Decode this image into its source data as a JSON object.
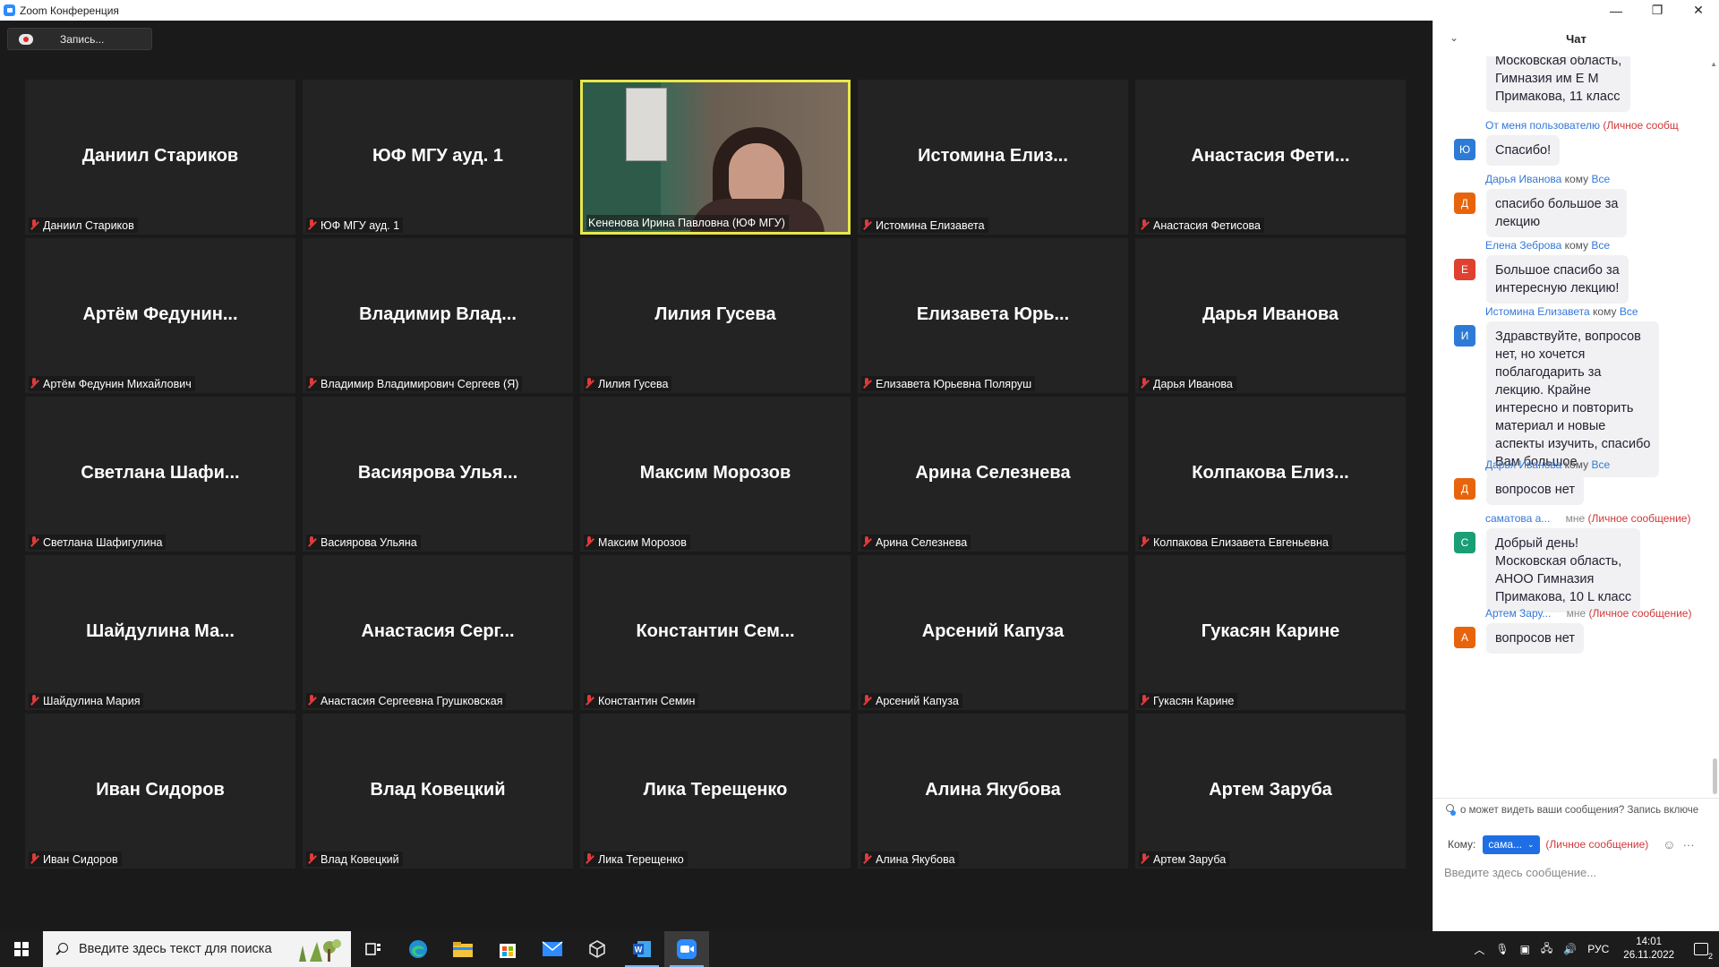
{
  "window": {
    "title": "Zoom Конференция",
    "controls": [
      "—",
      "❐",
      "✕"
    ]
  },
  "recording": {
    "label": "Запись..."
  },
  "speaker": {
    "name": "Keненова Ирина Павловна (ЮФ МГУ)"
  },
  "tiles": [
    {
      "big": "Даниил Стариков",
      "small": "Даниил Стариков"
    },
    {
      "big": "ЮФ МГУ ауд. 1",
      "small": "ЮФ МГУ ауд. 1"
    },
    {
      "big": "",
      "small": "Keненова Ирина Павловна (ЮФ МГУ)",
      "speaker": true
    },
    {
      "big": "Истомина  Елиз...",
      "small": "Истомина Елизавета"
    },
    {
      "big": "Анастасия  Фети...",
      "small": "Анастасия Фетисова"
    },
    {
      "big": "Артём  Федунин...",
      "small": "Артём Федунин Михайлович"
    },
    {
      "big": "Владимир  Влад...",
      "small": "Владимир Владимирович Сергеев (Я)"
    },
    {
      "big": "Лилия Гусева",
      "small": "Лилия Гусева"
    },
    {
      "big": "Елизавета  Юрь...",
      "small": "Елизавета Юрьевна Поляруш"
    },
    {
      "big": "Дарья Иванова",
      "small": "Дарья Иванова"
    },
    {
      "big": "Светлана  Шафи...",
      "small": "Светлана Шафигулина"
    },
    {
      "big": "Васиярова  Улья...",
      "small": "Васиярова Ульяна"
    },
    {
      "big": "Максим Морозов",
      "small": "Максим Морозов"
    },
    {
      "big": "Арина Селезнева",
      "small": "Арина Селезнева"
    },
    {
      "big": "Колпакова  Елиз...",
      "small": "Колпакова Елизавета Евгеньевна"
    },
    {
      "big": "Шайдулина  Ма...",
      "small": "Шайдулина Мария"
    },
    {
      "big": "Анастасия  Серг...",
      "small": "Анастасия Сергеевна Грушковская"
    },
    {
      "big": "Константин  Сем...",
      "small": "Константин Семин"
    },
    {
      "big": "Арсений Капуза",
      "small": "Арсений Капуза"
    },
    {
      "big": "Гукасян Карине",
      "small": "Гукасян Карине"
    },
    {
      "big": "Иван Сидоров",
      "small": "Иван Сидоров"
    },
    {
      "big": "Влад Ковецкий",
      "small": "Влад Ковецкий"
    },
    {
      "big": "Лика Терещенко",
      "small": "Лика Терещенко"
    },
    {
      "big": "Алина Якубова",
      "small": "Алина Якубова"
    },
    {
      "big": "Артем Заруба",
      "small": "Артем Заруба"
    }
  ],
  "chat": {
    "title": "Чат",
    "messages": [
      {
        "avatar": "",
        "avatar_color": "#1a9e75",
        "meta": null,
        "text": [
          "Московская область,",
          "Гимназия им Е М",
          "Примакова, 11 класс"
        ]
      },
      {
        "avatar": "Ю",
        "avatar_color": "#2d7bd6",
        "meta": {
          "sender": "От меня пользователю",
          "priv": "(Личное сообщ"
        },
        "text": [
          "Спасибо!"
        ]
      },
      {
        "avatar": "Д",
        "avatar_color": "#e8640c",
        "meta": {
          "sender": "Дарья Иванова",
          "kw": "кому",
          "all": "Все"
        },
        "text": [
          "спасибо большое за",
          "лекцию"
        ]
      },
      {
        "avatar": "Е",
        "avatar_color": "#e04030",
        "meta": {
          "sender": "Елена Зеброва",
          "kw": "кому",
          "all": "Все"
        },
        "text": [
          "Большое спасибо за",
          "интересную лекцию!"
        ]
      },
      {
        "avatar": "И",
        "avatar_color": "#2d7bd6",
        "meta": {
          "sender": "Истомина Елизавета",
          "kw": "кому",
          "all": "Все"
        },
        "text": [
          "Здравствуйте, вопросов",
          "нет, но хочется",
          "поблагодарить за",
          "лекцию. Крайне",
          "интересно и повторить",
          "материал и новые",
          "аспекты изучить, спасибо",
          "Вам большое"
        ]
      },
      {
        "avatar": "Д",
        "avatar_color": "#e8640c",
        "meta": {
          "sender": "Дарья Иванова",
          "kw": "кому",
          "all": "Все"
        },
        "text": [
          "вопросов нет"
        ]
      },
      {
        "avatar": "С",
        "avatar_color": "#1a9e75",
        "meta": {
          "sender": "саматова а...",
          "me": "мне",
          "priv": "(Личное сообщение)"
        },
        "text": [
          "Добрый день!",
          "Московская область,",
          "АНОО Гимназия",
          "Примакова, 10 L класс"
        ]
      },
      {
        "avatar": "А",
        "avatar_color": "#e8640c",
        "meta": {
          "sender": "Артем Зару...",
          "me": "мне",
          "priv": "(Личное сообщение)"
        },
        "text": [
          "вопросов нет"
        ]
      }
    ],
    "note": "о может видеть ваши сообщения? Запись включе",
    "to_label": "Кому:",
    "to_value": "сама...",
    "to_private": "(Личное сообщение)",
    "input_placeholder": "Введите здесь сообщение..."
  },
  "taskbar": {
    "search_placeholder": "Введите здесь текст для поиска",
    "lang": "РУС",
    "time": "14:01",
    "date": "26.11.2022",
    "notifications": "2"
  }
}
